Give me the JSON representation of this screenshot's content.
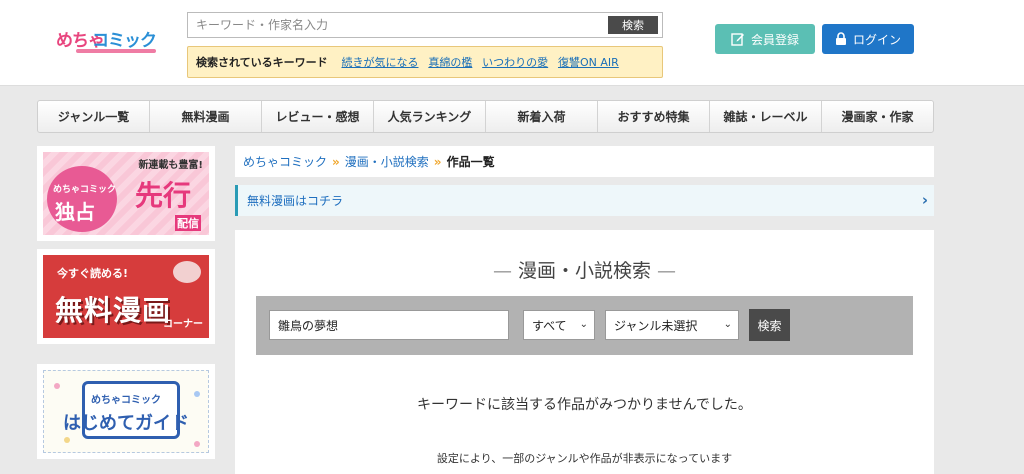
{
  "header": {
    "logo_part1": "めちゃ",
    "logo_part2": "コミック",
    "search_placeholder": "キーワード・作家名入力",
    "search_button": "検索",
    "keywords_title": "検索されているキーワード",
    "keywords": [
      "続きが気になる",
      "真綿の檻",
      "いつわりの愛",
      "復讐ON AIR"
    ],
    "register_label": "会員登録",
    "login_label": "ログイン"
  },
  "nav": {
    "items": [
      "ジャンル一覧",
      "無料漫画",
      "レビュー・感想",
      "人気ランキング",
      "新着入荷",
      "おすすめ特集",
      "雑誌・レーベル",
      "漫画家・作家"
    ]
  },
  "banners": {
    "exclusive": {
      "top": "新連載も豊富!",
      "brand": "めちゃコミック",
      "main": "独占",
      "side": "先行",
      "sub": "配信"
    },
    "free": {
      "top": "今すぐ読める!",
      "main": "無料漫画",
      "sub": "コーナー"
    },
    "guide": {
      "brand": "めちゃコミック",
      "main": "はじめてガイド"
    }
  },
  "breadcrumb": {
    "items": [
      "めちゃコミック",
      "漫画・小説検索"
    ],
    "current": "作品一覧",
    "separator": "»"
  },
  "free_banner": {
    "label": "無料漫画はコチラ"
  },
  "main": {
    "title": "漫画・小説検索",
    "title_dash": "—",
    "keyword_value": "雛鳥の夢想",
    "scope_selected": "すべて",
    "genre_selected": "ジャンル未選択",
    "search_button": "検索",
    "no_result": "キーワードに該当する作品がみつかりませんでした。",
    "note": "設定により、一部のジャンルや作品が非表示になっています"
  },
  "colors": {
    "register": "#5bbfb4",
    "login": "#1f76c8",
    "link": "#1f6fbf",
    "keyword_bg": "#fff1c4"
  },
  "icons": {
    "register": "edit-icon",
    "login": "lock-icon",
    "chevron": "chevron-right-icon",
    "select_arrow": "chevron-down-icon"
  }
}
